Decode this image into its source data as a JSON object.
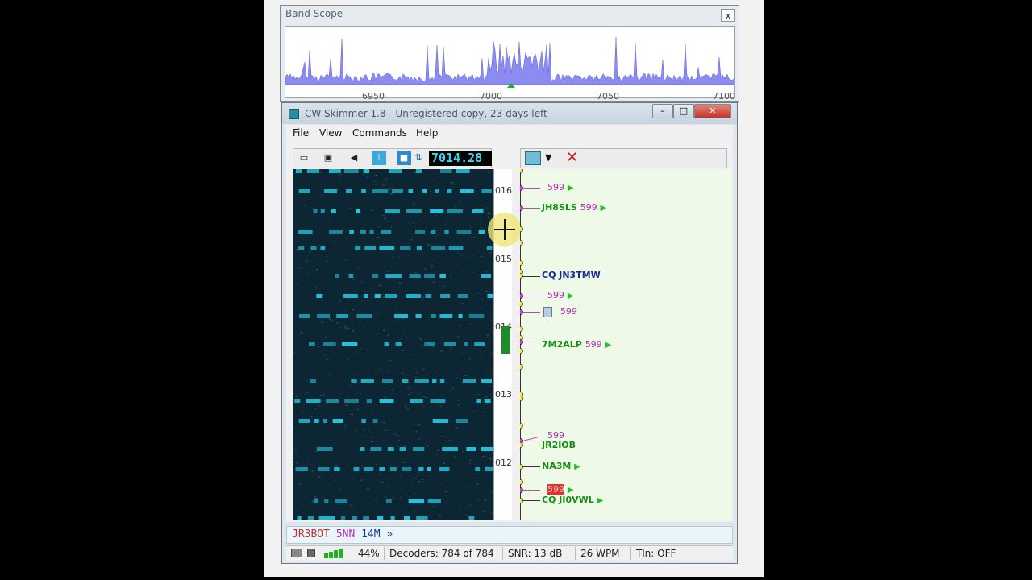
{
  "band_scope": {
    "title": "Band Scope",
    "close_label": "x",
    "ticks": [
      "6950",
      "7000",
      "7050",
      "7100"
    ]
  },
  "window": {
    "title": "CW Skimmer 1.8 - Unregistered copy, 23 days left",
    "min_label": "–",
    "max_label": "□",
    "close_label": "✕"
  },
  "menu": {
    "file": "File",
    "view": "View",
    "commands": "Commands",
    "help": "Help"
  },
  "frequency": "7014.28",
  "scale_labels": [
    "016",
    "015",
    "014",
    "013",
    "012"
  ],
  "spots": {
    "s1": {
      "rst": "599"
    },
    "s2": {
      "call": "JH8SLS",
      "rst": "599"
    },
    "s3": {
      "call": "CQ JN3TMW"
    },
    "s4": {
      "rst": "599"
    },
    "s5": {
      "rst": "599"
    },
    "s6": {
      "call": "7M2ALP",
      "rst": "599"
    },
    "s7": {
      "rst": "599",
      "call": "JR2IOB"
    },
    "s8": {
      "call": "NA3M"
    },
    "s9": {
      "rst": "599"
    },
    "s10": {
      "call": "CQ JI0VWL"
    }
  },
  "text_line": {
    "call": "JR3BOT",
    "rst": "5NN",
    "band": "14M",
    "more": "»"
  },
  "status": {
    "level_pct": "44%",
    "decoders": "Decoders: 784 of 784",
    "snr": "SNR: 13 dB",
    "wpm": "26 WPM",
    "tln": "Tln: OFF"
  },
  "colors": {
    "waterfall_bg": "#0c2633",
    "signal": "#27c6e0",
    "spot_bg": "#eef9e8",
    "scope_fill": "#8c8cf0"
  }
}
